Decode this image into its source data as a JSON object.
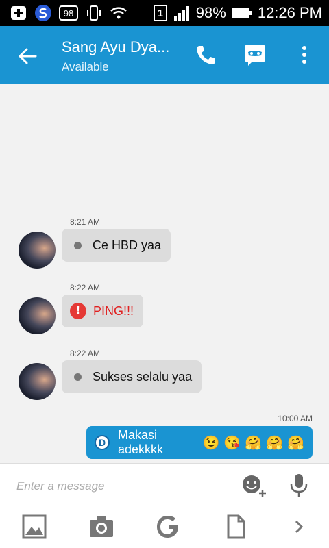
{
  "status_bar": {
    "battery": "98%",
    "time": "12:26 PM",
    "sim_label": "1",
    "notif_label": "98"
  },
  "header": {
    "title": "Sang Ayu Dya...",
    "subtitle": "Available"
  },
  "messages": [
    {
      "time": "8:21 AM",
      "text": "Ce HBD yaa",
      "direction": "incoming",
      "kind": "text"
    },
    {
      "time": "8:22 AM",
      "text": "PING!!!",
      "direction": "incoming",
      "kind": "ping"
    },
    {
      "time": "8:22 AM",
      "text": "Sukses selalu yaa",
      "direction": "incoming",
      "kind": "text"
    },
    {
      "time": "10:00 AM",
      "text": "Makasi adekkkk",
      "direction": "outgoing",
      "kind": "text",
      "badge": "D",
      "emojis": [
        "😉",
        "😘",
        "🤗",
        "🤗",
        "🤗"
      ]
    }
  ],
  "composer": {
    "placeholder": "Enter a message"
  },
  "colors": {
    "accent": "#1a94d2",
    "bubble_in": "#dcdcdc",
    "ping_red": "#e53935"
  },
  "icons": {
    "back": "arrow-left-icon",
    "call": "phone-icon",
    "video": "mask-chat-icon",
    "more": "more-vert-icon",
    "emoji_add": "emoji-add-icon",
    "mic": "microphone-icon",
    "image": "image-icon",
    "camera": "camera-icon",
    "google": "google-icon",
    "file": "file-icon",
    "next": "chevron-right-icon"
  }
}
